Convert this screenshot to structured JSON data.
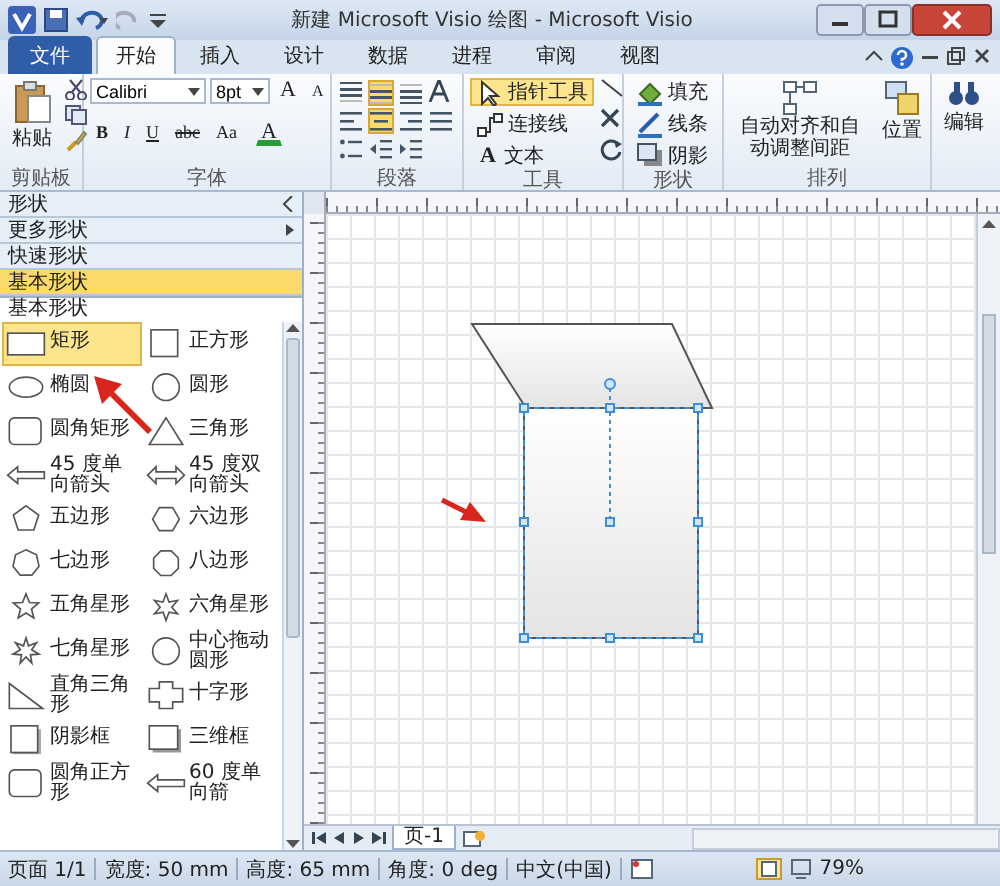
{
  "window": {
    "title": "新建 Microsoft Visio 绘图 - Microsoft Visio"
  },
  "tabs": [
    {
      "label": "文件",
      "kind": "file",
      "selected": false
    },
    {
      "label": "开始",
      "kind": "tab",
      "selected": true
    },
    {
      "label": "插入",
      "kind": "tab",
      "selected": false
    },
    {
      "label": "设计",
      "kind": "tab",
      "selected": false
    },
    {
      "label": "数据",
      "kind": "tab",
      "selected": false
    },
    {
      "label": "进程",
      "kind": "tab",
      "selected": false
    },
    {
      "label": "审阅",
      "kind": "tab",
      "selected": false
    },
    {
      "label": "视图",
      "kind": "tab",
      "selected": false
    }
  ],
  "ribbon": {
    "groups": [
      {
        "kind": "clipboard",
        "label": "剪贴板",
        "paste": "粘贴"
      },
      {
        "kind": "font",
        "label": "字体",
        "font": "Calibri",
        "size": "8pt",
        "grow": "A",
        "shrink": "A",
        "styles": [
          "B",
          "I",
          "U",
          "abc",
          "Aa"
        ],
        "color_letter": "A"
      },
      {
        "kind": "paragraph",
        "label": "段落",
        "buttons": [
          {
            "kind": "align-top",
            "selected": false
          },
          {
            "kind": "align-middle",
            "selected": true
          },
          {
            "kind": "align-bottom",
            "selected": false
          },
          {
            "kind": "align-left",
            "selected": false
          },
          {
            "kind": "align-center",
            "selected": true
          },
          {
            "kind": "align-right",
            "selected": false
          },
          {
            "kind": "justify",
            "selected": false
          },
          {
            "kind": "bullets",
            "selected": false
          },
          {
            "kind": "outdent",
            "selected": false
          },
          {
            "kind": "indent",
            "selected": false
          }
        ]
      },
      {
        "kind": "tools",
        "label": "工具",
        "items": [
          {
            "kind": "pointer",
            "label": "指针工具",
            "selected": true
          },
          {
            "kind": "connector",
            "label": "连接线",
            "selected": false
          },
          {
            "kind": "text",
            "label": "文本",
            "glyph": "A",
            "selected": false
          }
        ]
      },
      {
        "kind": "shape",
        "label": "形状",
        "items": [
          {
            "kind": "fill",
            "label": "填充"
          },
          {
            "kind": "line",
            "label": "线条"
          },
          {
            "kind": "shadow",
            "label": "阴影"
          }
        ]
      },
      {
        "kind": "arrange",
        "label": "排列",
        "auto_align": "自动对齐和自动调整间距",
        "position": "位置"
      },
      {
        "kind": "editing",
        "button": "编辑"
      }
    ]
  },
  "shapes_panel": {
    "headers": [
      {
        "label": "形状",
        "kind": "collapse",
        "selected": false
      },
      {
        "label": "更多形状",
        "kind": "submenu",
        "selected": false
      },
      {
        "label": "快速形状",
        "kind": "plain",
        "selected": false
      },
      {
        "label": "基本形状",
        "kind": "plain",
        "selected": true
      }
    ],
    "stencil_title": "基本形状",
    "shapes": [
      {
        "kind": "rectangle",
        "label": "矩形",
        "selected": true
      },
      {
        "kind": "square",
        "label": "正方形",
        "selected": false
      },
      {
        "kind": "ellipse",
        "label": "椭圆",
        "selected": false
      },
      {
        "kind": "circle",
        "label": "圆形",
        "selected": false
      },
      {
        "kind": "rounded-rectangle",
        "label": "圆角矩形",
        "selected": false
      },
      {
        "kind": "triangle",
        "label": "三角形",
        "selected": false
      },
      {
        "kind": "arrow",
        "label": "45 度单向箭头",
        "selected": false
      },
      {
        "kind": "double-arrow",
        "label": "45 度双向箭头",
        "selected": false
      },
      {
        "kind": "pentagon",
        "label": "五边形",
        "selected": false
      },
      {
        "kind": "hexagon",
        "label": "六边形",
        "selected": false
      },
      {
        "kind": "heptagon",
        "label": "七边形",
        "selected": false
      },
      {
        "kind": "octagon",
        "label": "八边形",
        "selected": false
      },
      {
        "kind": "star5",
        "label": "五角星形",
        "selected": false
      },
      {
        "kind": "star6",
        "label": "六角星形",
        "selected": false
      },
      {
        "kind": "star7",
        "label": "七角星形",
        "selected": false
      },
      {
        "kind": "circle",
        "label": "中心拖动圆形",
        "selected": false
      },
      {
        "kind": "right-triangle",
        "label": "直角三角形",
        "selected": false
      },
      {
        "kind": "cross",
        "label": "十字形",
        "selected": false
      },
      {
        "kind": "shadow-box",
        "label": "阴影框",
        "selected": false
      },
      {
        "kind": "box-3d",
        "label": "三维框",
        "selected": false
      },
      {
        "kind": "rounded-square",
        "label": "圆角正方形",
        "selected": false
      },
      {
        "kind": "arrow",
        "label": "60 度单向箭",
        "selected": false
      }
    ]
  },
  "page_tabs": [
    {
      "label": "页-1",
      "selected": true
    }
  ],
  "status_bar": {
    "items": [
      "页面 1/1",
      "宽度: 50 mm",
      "高度: 65 mm",
      "角度: 0 deg",
      "中文(中国)"
    ],
    "zoom": "79%"
  }
}
